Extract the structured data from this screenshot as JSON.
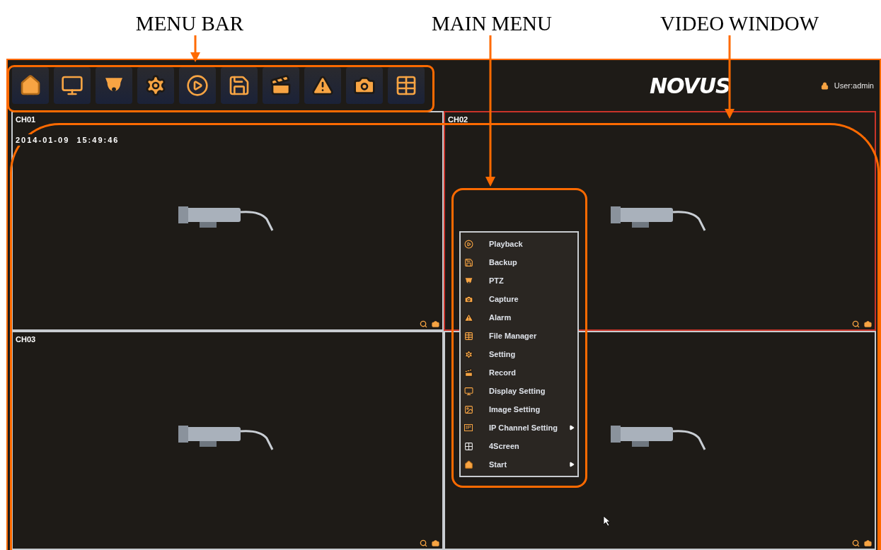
{
  "callouts": [
    {
      "label": "MENU BAR"
    },
    {
      "label": "MAIN MENU"
    },
    {
      "label": "VIDEO WINDOW"
    }
  ],
  "menu_bar": {
    "buttons": [
      {
        "kind": "home"
      },
      {
        "kind": "display"
      },
      {
        "kind": "ptz"
      },
      {
        "kind": "setting"
      },
      {
        "kind": "playback"
      },
      {
        "kind": "backup"
      },
      {
        "kind": "record"
      },
      {
        "kind": "alarm"
      },
      {
        "kind": "capture"
      },
      {
        "kind": "file"
      }
    ],
    "logo": "NOVUS",
    "user": "User:admin"
  },
  "channels": [
    {
      "label": "CH01",
      "timestamp": "2014-01-09  15:49:46",
      "selected": false
    },
    {
      "label": "CH02",
      "selected": true
    },
    {
      "label": "CH03",
      "selected": false
    },
    {
      "selected": false
    }
  ],
  "main_menu": [
    {
      "kind": "playback",
      "label": "Playback",
      "submenu": false
    },
    {
      "kind": "backup",
      "label": "Backup",
      "submenu": false
    },
    {
      "kind": "ptz",
      "label": "PTZ",
      "submenu": false
    },
    {
      "kind": "capture",
      "label": "Capture",
      "submenu": false
    },
    {
      "kind": "alarm",
      "label": "Alarm",
      "submenu": false
    },
    {
      "kind": "file",
      "label": "File Manager",
      "submenu": false
    },
    {
      "kind": "setting",
      "label": "Setting",
      "submenu": false
    },
    {
      "kind": "record",
      "label": "Record",
      "submenu": false
    },
    {
      "kind": "display",
      "label": "Display Setting",
      "submenu": false
    },
    {
      "kind": "image",
      "label": "Image Setting",
      "submenu": false
    },
    {
      "kind": "ip",
      "icon_text": "IP",
      "label": "IP Channel Setting",
      "submenu": true
    },
    {
      "kind": "grid",
      "label": "4Screen",
      "submenu": false
    },
    {
      "kind": "home",
      "label": "Start",
      "submenu": true
    }
  ]
}
